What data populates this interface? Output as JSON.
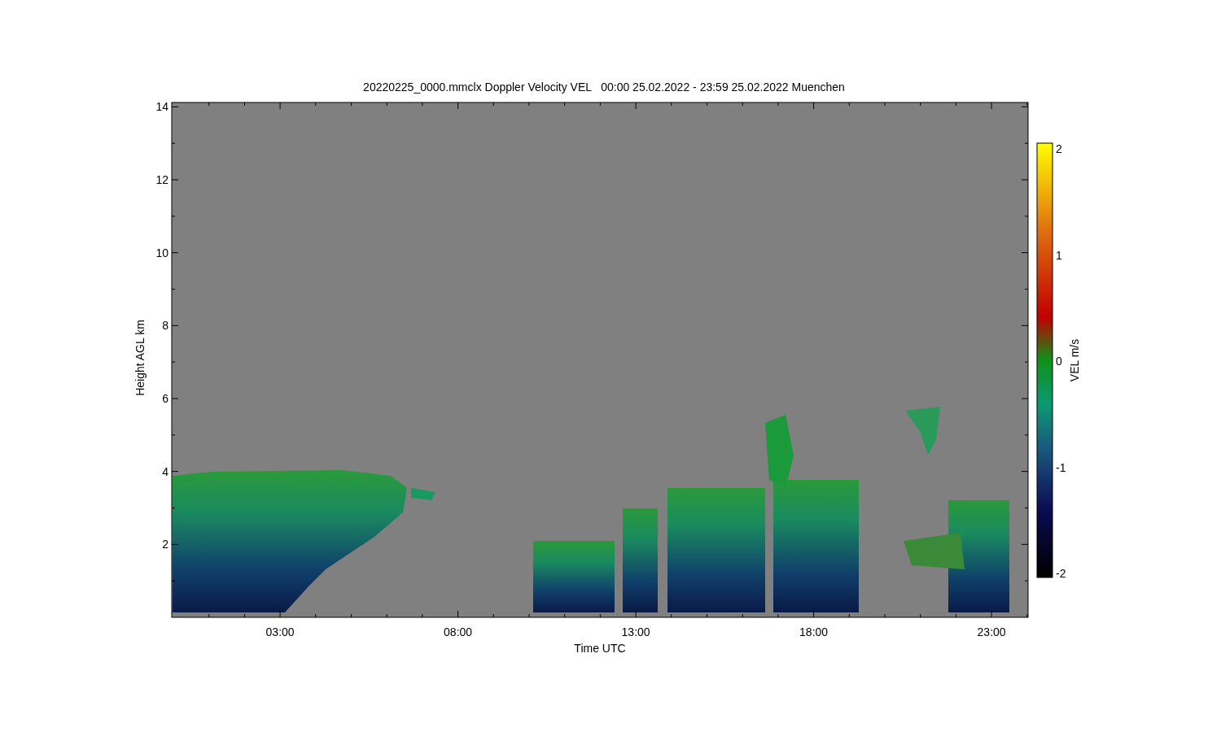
{
  "plot": {
    "title": "20220225_0000.mmclx Doppler Velocity VEL   00:00 25.02.2022 - 23:59 25.02.2022 Muenchen",
    "ylabel": "Height AGL km",
    "yticks": [
      "14",
      "12",
      "10",
      "8",
      "6",
      "4",
      "2"
    ],
    "xlabel": "Time UTC",
    "xticks": [
      "03:00",
      "08:00",
      "13:00",
      "18:00",
      "23:00"
    ]
  },
  "colorbar": {
    "label": "VEL m/s",
    "ticks": [
      "2",
      "1",
      "0",
      "-1",
      "-2"
    ]
  }
}
